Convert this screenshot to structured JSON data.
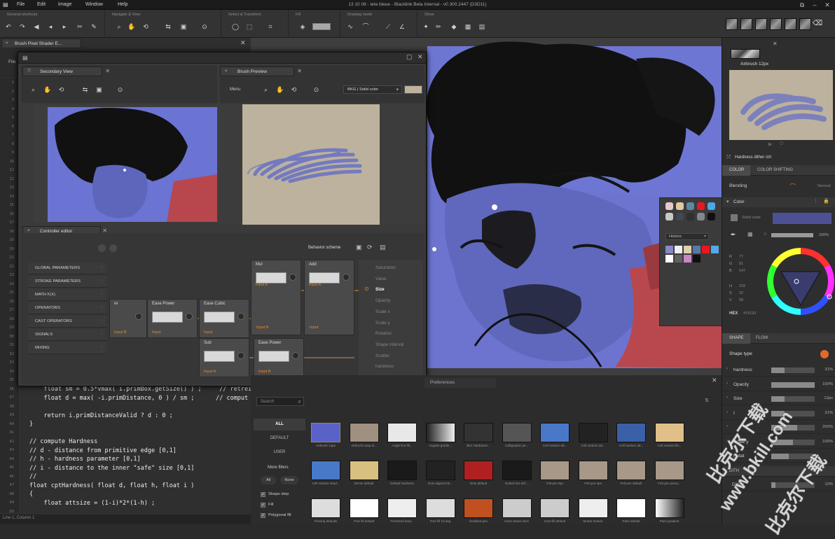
{
  "menubar": {
    "items": [
      "File",
      "Edit",
      "Image",
      "Window",
      "Help"
    ],
    "title": "13 10 08 - tete bleue - Blacklink Beta Internal - v0.300.2447 (D3D11)"
  },
  "toolbar": {
    "sections": [
      "General shortcuts",
      "Navigate & View",
      "Select & Transform",
      "Fill",
      "Drawing mode",
      "Show"
    ]
  },
  "editor": {
    "tab": "Brush Pixel Shader E...",
    "file_menu": "File",
    "line_numbers": [
      "1",
      "2",
      "3",
      "4",
      "5",
      "6",
      "7",
      "8",
      "9",
      "10",
      "11",
      "12",
      "13",
      "14",
      "15",
      "16",
      "17",
      "18",
      "19",
      "20",
      "21",
      "22",
      "23",
      "24",
      "25",
      "26",
      "27",
      "28",
      "29",
      "30",
      "31",
      "32",
      "33",
      "34",
      "35",
      "36",
      "37",
      "38",
      "39",
      "40",
      "41",
      "42",
      "43",
      "44",
      "45",
      "46",
      "47",
      "48",
      "49",
      "50"
    ],
    "code_lines": [
      "    float sm = 0.5*vmax( i.primBox.getSize() ) ;     // retrei",
      "    float d = max( -i.primDistance, 0 ) / sm ;      // comput",
      "",
      "    return i.primDistanceValid ? d : 0 ;",
      "}",
      "",
      "// compute Hardness",
      "// d - distance from primitive edge [0,1]",
      "// h - hardness parameter [0,1]",
      "// i - distance to the inner \"safe\" size [0,1]",
      "//",
      "float cptHardness( float d, float h, float i )",
      "{",
      "    float attsize = (1-i)*2*(1-h) ;"
    ],
    "status": "Line 1, Column 1"
  },
  "floatwin": {
    "secondary_view_tab": "Secondary View",
    "brush_preview_tab": "Brush Preview",
    "menu_label": "Menu",
    "bkg_select": "BKG | Solid color",
    "controller_editor_tab": "Controller editor",
    "behavior_scheme": "Behavior scheme",
    "parameters": [
      "GLOBAL PARAMETERS",
      "STROKE PARAMETERS",
      "MATH F(X)",
      "OPERATORS",
      "CAST OPERATORS",
      "SIGNALS",
      "MIXING"
    ],
    "nodes": [
      {
        "title": "Mul",
        "input": "Input A"
      },
      {
        "title": "Add",
        "input": "Input A"
      },
      {
        "title": "Ease Power",
        "input": "Input"
      },
      {
        "title": "Ease Cubic",
        "input": "Input"
      },
      {
        "title": "Sub",
        "input": "Input A"
      },
      {
        "title": "Ease Power",
        "input": "Input B"
      }
    ],
    "partial_node_title": "re",
    "node_inputs": [
      "Input B",
      "Input",
      "Input B"
    ],
    "outputs": [
      "Saturation",
      "Value",
      "Size",
      "Opacity",
      "Scale x",
      "Scale y",
      "Rotation",
      "Shape interval",
      "Scatter",
      "hardness"
    ],
    "active_output": "Size"
  },
  "palette": {
    "historic": "Historic",
    "top_colors": [
      "#e8c8c8",
      "#e0c8a0",
      "#5a8aa0",
      "#e81820",
      "#4aa8e8",
      "#c8c8c8",
      "#404850",
      "#303030",
      "#808890",
      "#101010"
    ],
    "hist_colors": [
      "#8888c8",
      "#f0f0f0",
      "#e0d0b0",
      "#5878a8",
      "#e81820",
      "#58a8e8",
      "#ffffff",
      "#606060",
      "#c888c8",
      "#101010"
    ]
  },
  "rpanel": {
    "brush_name": "Airbrush 12px",
    "hardness_ctrl": "Hardness dither ctrl",
    "color_tab": "COLOR",
    "color_shifting_tab": "COLOR SHIFTING",
    "blending_label": "Blending",
    "blending_value": "Normal",
    "color_label": "Color",
    "solid_color": "Solid color",
    "opacity_value": "100%",
    "rgb": [
      {
        "k": "R",
        "v": "77"
      },
      {
        "k": "G",
        "v": "81"
      },
      {
        "k": "B",
        "v": "147"
      }
    ],
    "hsv": [
      {
        "k": "H",
        "v": "232"
      },
      {
        "k": "S",
        "v": "32"
      },
      {
        "k": "V",
        "v": "58"
      }
    ],
    "hex_label": "HEX",
    "hex_value": "475193",
    "current_color": "#4d5193",
    "shape_tab": "SHAPE",
    "flow_tab": "FLOW",
    "shape_type": "Shape type",
    "params": [
      {
        "k": "hardness",
        "v": "31%",
        "f": 0.31
      },
      {
        "k": "Opacity",
        "v": "100%",
        "f": 1.0
      },
      {
        "k": "Size",
        "v": "12px",
        "f": 0.3
      },
      {
        "k": "I",
        "v": "31%",
        "f": 0.31
      },
      {
        "k": "",
        "v": "260%",
        "f": 0.6
      },
      {
        "k": "Scale y",
        "v": "100%",
        "f": 0.5
      },
      {
        "k": "Rotat",
        "v": "",
        "f": 0.4
      }
    ],
    "dither_tab": "DITH",
    "dither_row": "Dither",
    "dither_value": "10%"
  },
  "browser": {
    "tab_label": "Preferences",
    "search_placeholder": "Search",
    "categories": [
      "ALL",
      "DEFAULT",
      "USER"
    ],
    "more_filters": "More filters",
    "all_btn": "All",
    "none_btn": "None",
    "checks": [
      "Shape step",
      "Fill",
      "Polygonal fill"
    ],
    "captions_row1": [
      "Airbrush 12px",
      "Airbrush soap di...",
      "Angle line fill...",
      "Angular gradie...",
      "Blur Harddown...",
      "Calligraphic pe...",
      "Cell random dd...",
      "Cell random dd...",
      "Cell random dd...",
      "Cell random fib..."
    ],
    "captions_row2": [
      "Cell random shad...",
      "Dense default",
      "Default hardness",
      "Dots aligned de...",
      "Dots default",
      "Dotted line def...",
      "Felt pen 8px",
      "Felt pen 4px",
      "Felt pen default",
      "Felt pen peruv..."
    ],
    "captions_row3": [
      "Flowing defaults",
      "Free fill default",
      "Freehand hard...",
      "Free fill 15 deg",
      "Gradient pen",
      "Hand drawn lines",
      "Hard fill default",
      "Mortar texture",
      "Paint default",
      "Paint gradient"
    ]
  },
  "watermark": {
    "line1": "比克尔下载",
    "line2": "www.bkill.com",
    "line3": "比克尔下载"
  }
}
